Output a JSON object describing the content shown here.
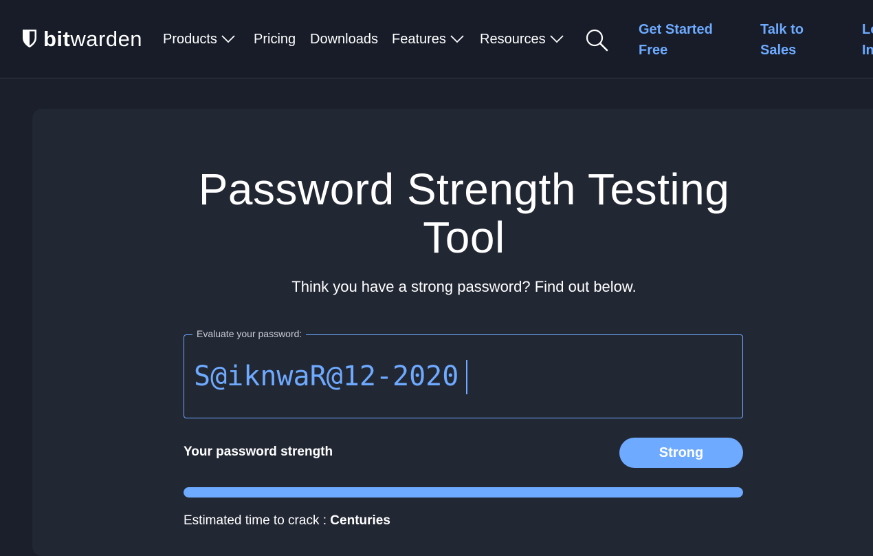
{
  "nav": {
    "logo_bold": "bit",
    "logo_light": "warden",
    "items": [
      {
        "label": "Products",
        "dropdown": true
      },
      {
        "label": "Pricing",
        "dropdown": false
      },
      {
        "label": "Downloads",
        "dropdown": false
      },
      {
        "label": "Features",
        "dropdown": true
      },
      {
        "label": "Resources",
        "dropdown": true
      }
    ],
    "search_icon": "search-icon",
    "cta_get_started": [
      "Get Started",
      "Free"
    ],
    "cta_talk_sales": [
      "Talk to",
      "Sales"
    ],
    "cta_login_partial": [
      "Lo",
      "In"
    ]
  },
  "main": {
    "title_line1": "Password Strength Testing",
    "title_line2": "Tool",
    "subtitle": "Think you have a strong password? Find out below.",
    "field_label": "Evaluate your password:",
    "password_value": "S@iknwaR@12-2020",
    "strength_label": "Your password strength",
    "strength_value": "Strong",
    "strength_fraction": 1.0,
    "crack_label": "Estimated time to crack : ",
    "crack_value": "Centuries"
  },
  "colors": {
    "accent": "#6eaaff",
    "nav_bg": "#171c28",
    "card_bg": "#222734",
    "page_bg": "#1a1f2b"
  }
}
